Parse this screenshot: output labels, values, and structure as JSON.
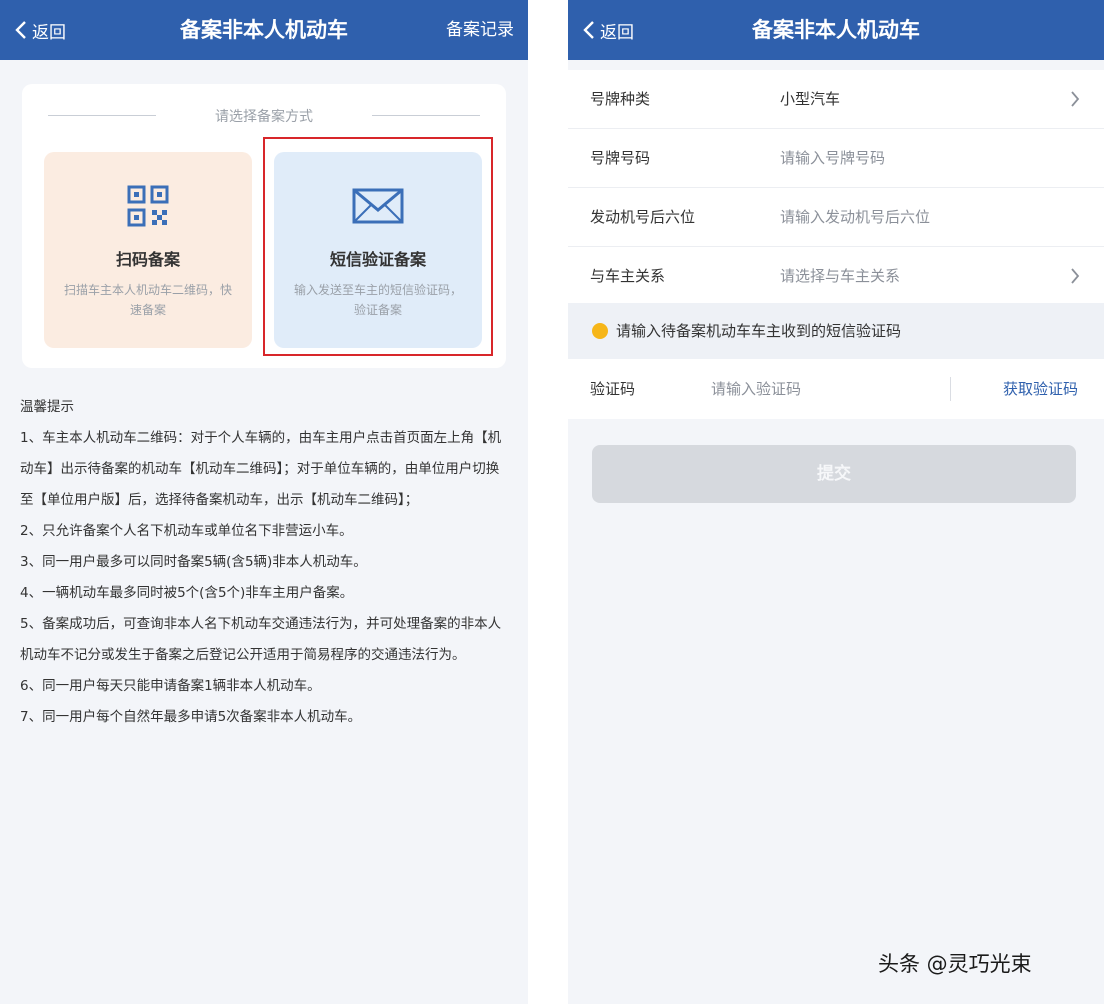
{
  "left": {
    "header": {
      "back_label": "返回",
      "title": "备案非本人机动车",
      "records_label": "备案记录"
    },
    "card": {
      "title": "请选择备案方式",
      "options": [
        {
          "label": "扫码备案",
          "desc": "扫描车主本人机动车二维码，快速备案",
          "icon": "qr-code-icon"
        },
        {
          "label": "短信验证备案",
          "desc": "输入发送至车主的短信验证码，验证备案",
          "icon": "envelope-icon"
        }
      ]
    },
    "tips": {
      "title": "温馨提示",
      "items": [
        "1、车主本人机动车二维码：对于个人车辆的，由车主用户点击首页面左上角【机动车】出示待备案的机动车【机动车二维码】；对于单位车辆的，由单位用户切换至【单位用户版】后，选择待备案机动车，出示【机动车二维码】；",
        "2、只允许备案个人名下机动车或单位名下非营运小车。",
        "3、同一用户最多可以同时备案5辆(含5辆)非本人机动车。",
        "4、一辆机动车最多同时被5个(含5个)非车主用户备案。",
        "5、备案成功后，可查询非本人名下机动车交通违法行为，并可处理备案的非本人机动车不记分或发生于备案之后登记公开适用于简易程序的交通违法行为。",
        "6、同一用户每天只能申请备案1辆非本人机动车。",
        "7、同一用户每个自然年最多申请5次备案非本人机动车。"
      ]
    }
  },
  "right": {
    "header": {
      "back_label": "返回",
      "title": "备案非本人机动车"
    },
    "form": [
      {
        "label": "号牌种类",
        "value": "小型汽车",
        "placeholder": "",
        "chevron": true
      },
      {
        "label": "号牌号码",
        "value": "",
        "placeholder": "请输入号牌号码",
        "chevron": false
      },
      {
        "label": "发动机号后六位",
        "value": "",
        "placeholder": "请输入发动机号后六位",
        "chevron": false
      },
      {
        "label": "与车主关系",
        "value": "",
        "placeholder": "请选择与车主关系",
        "chevron": true
      }
    ],
    "notice": "请输入待备案机动车车主收到的短信验证码",
    "verify": {
      "label": "验证码",
      "placeholder": "请输入验证码",
      "get_code": "获取验证码"
    },
    "submit": "提交"
  },
  "watermark": "头条 @灵巧光束",
  "colors": {
    "header": "#2f60ad",
    "accent": "#2f60ad",
    "highlight_border": "#d8262a",
    "notice_dot": "#f6b619"
  }
}
